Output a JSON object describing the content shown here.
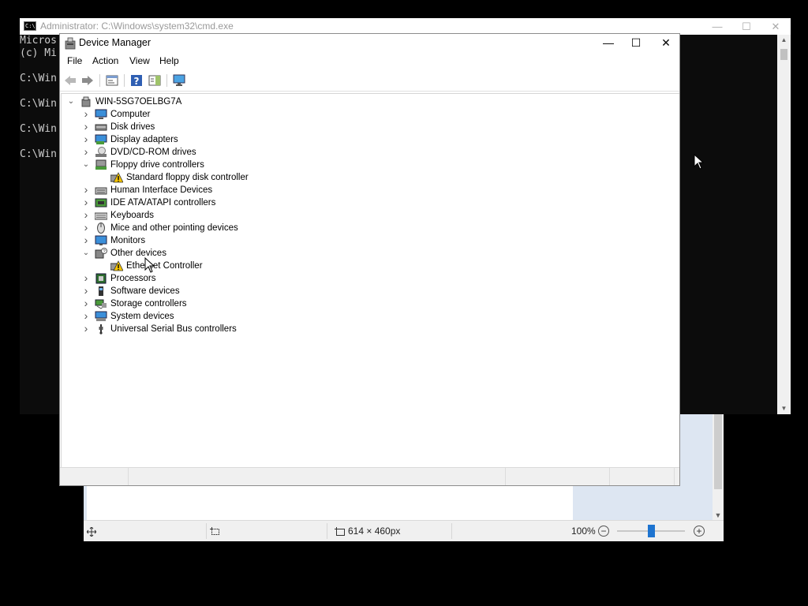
{
  "cmd": {
    "title": "Administrator: C:\\Windows\\system32\\cmd.exe",
    "lines": [
      "Micros",
      "(c) Mi",
      "",
      "C:\\Win",
      "",
      "C:\\Win",
      "",
      "C:\\Win",
      "",
      "C:\\Win"
    ]
  },
  "device_manager": {
    "title": "Device Manager",
    "menu": [
      "File",
      "Action",
      "View",
      "Help"
    ],
    "root": "WIN-5SG7OELBG7A",
    "nodes": [
      {
        "label": "Computer",
        "icon": "computer-icon",
        "expanded": false
      },
      {
        "label": "Disk drives",
        "icon": "disk-drive-icon",
        "expanded": false
      },
      {
        "label": "Display adapters",
        "icon": "display-adapter-icon",
        "expanded": false
      },
      {
        "label": "DVD/CD-ROM drives",
        "icon": "dvd-drive-icon",
        "expanded": false
      },
      {
        "label": "Floppy drive controllers",
        "icon": "floppy-controller-icon",
        "expanded": true
      },
      {
        "label": "Standard floppy disk controller",
        "icon": "warning-device-icon",
        "child": true
      },
      {
        "label": "Human Interface Devices",
        "icon": "hid-icon",
        "expanded": false
      },
      {
        "label": "IDE ATA/ATAPI controllers",
        "icon": "ide-controller-icon",
        "expanded": false
      },
      {
        "label": "Keyboards",
        "icon": "keyboard-icon",
        "expanded": false
      },
      {
        "label": "Mice and other pointing devices",
        "icon": "mouse-icon",
        "expanded": false
      },
      {
        "label": "Monitors",
        "icon": "monitor-icon",
        "expanded": false
      },
      {
        "label": "Other devices",
        "icon": "other-devices-icon",
        "expanded": true
      },
      {
        "label": "Ethernet Controller",
        "icon": "warning-device-icon",
        "child": true
      },
      {
        "label": "Processors",
        "icon": "processor-icon",
        "expanded": false
      },
      {
        "label": "Software devices",
        "icon": "software-device-icon",
        "expanded": false
      },
      {
        "label": "Storage controllers",
        "icon": "storage-controller-icon",
        "expanded": false
      },
      {
        "label": "System devices",
        "icon": "system-devices-icon",
        "expanded": false
      },
      {
        "label": "Universal Serial Bus controllers",
        "icon": "usb-icon",
        "expanded": false
      }
    ]
  },
  "paint": {
    "status": {
      "dimensions": "614 × 460px",
      "zoom": "100%"
    },
    "zoom_level": 100
  },
  "colors": {
    "accent": "#1e74d0",
    "warning": "#f5c400"
  }
}
